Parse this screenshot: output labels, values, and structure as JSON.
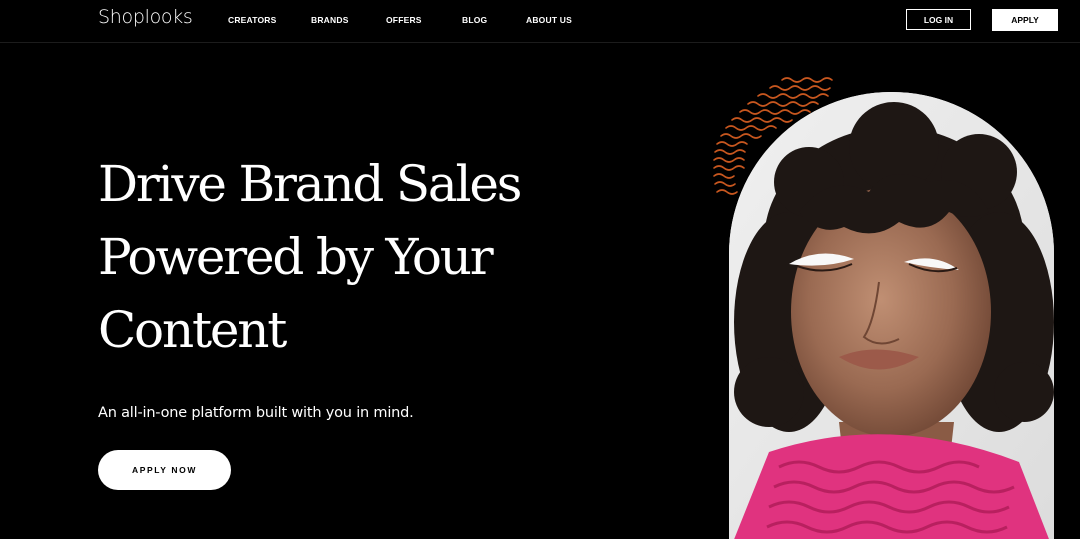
{
  "header": {
    "logo": "Shoplooks",
    "nav": [
      {
        "label": "CREATORS"
      },
      {
        "label": "BRANDS"
      },
      {
        "label": "OFFERS"
      },
      {
        "label": "BLOG"
      },
      {
        "label": "ABOUT US"
      }
    ],
    "login_label": "LOG IN",
    "apply_label": "APPLY"
  },
  "hero": {
    "title_lines": [
      "Drive Brand Sales",
      "Powered by Your",
      "Content"
    ],
    "subtitle": "An all-in-one platform built with you in mind.",
    "cta_label": "APPLY NOW"
  },
  "colors": {
    "background": "#000000",
    "text": "#ffffff",
    "wave_accent": "#c8571f",
    "scarf_pink": "#e0337f"
  },
  "icons": {
    "decoration": "wavy-lines-graphic",
    "photo": "model-portrait-photo"
  }
}
